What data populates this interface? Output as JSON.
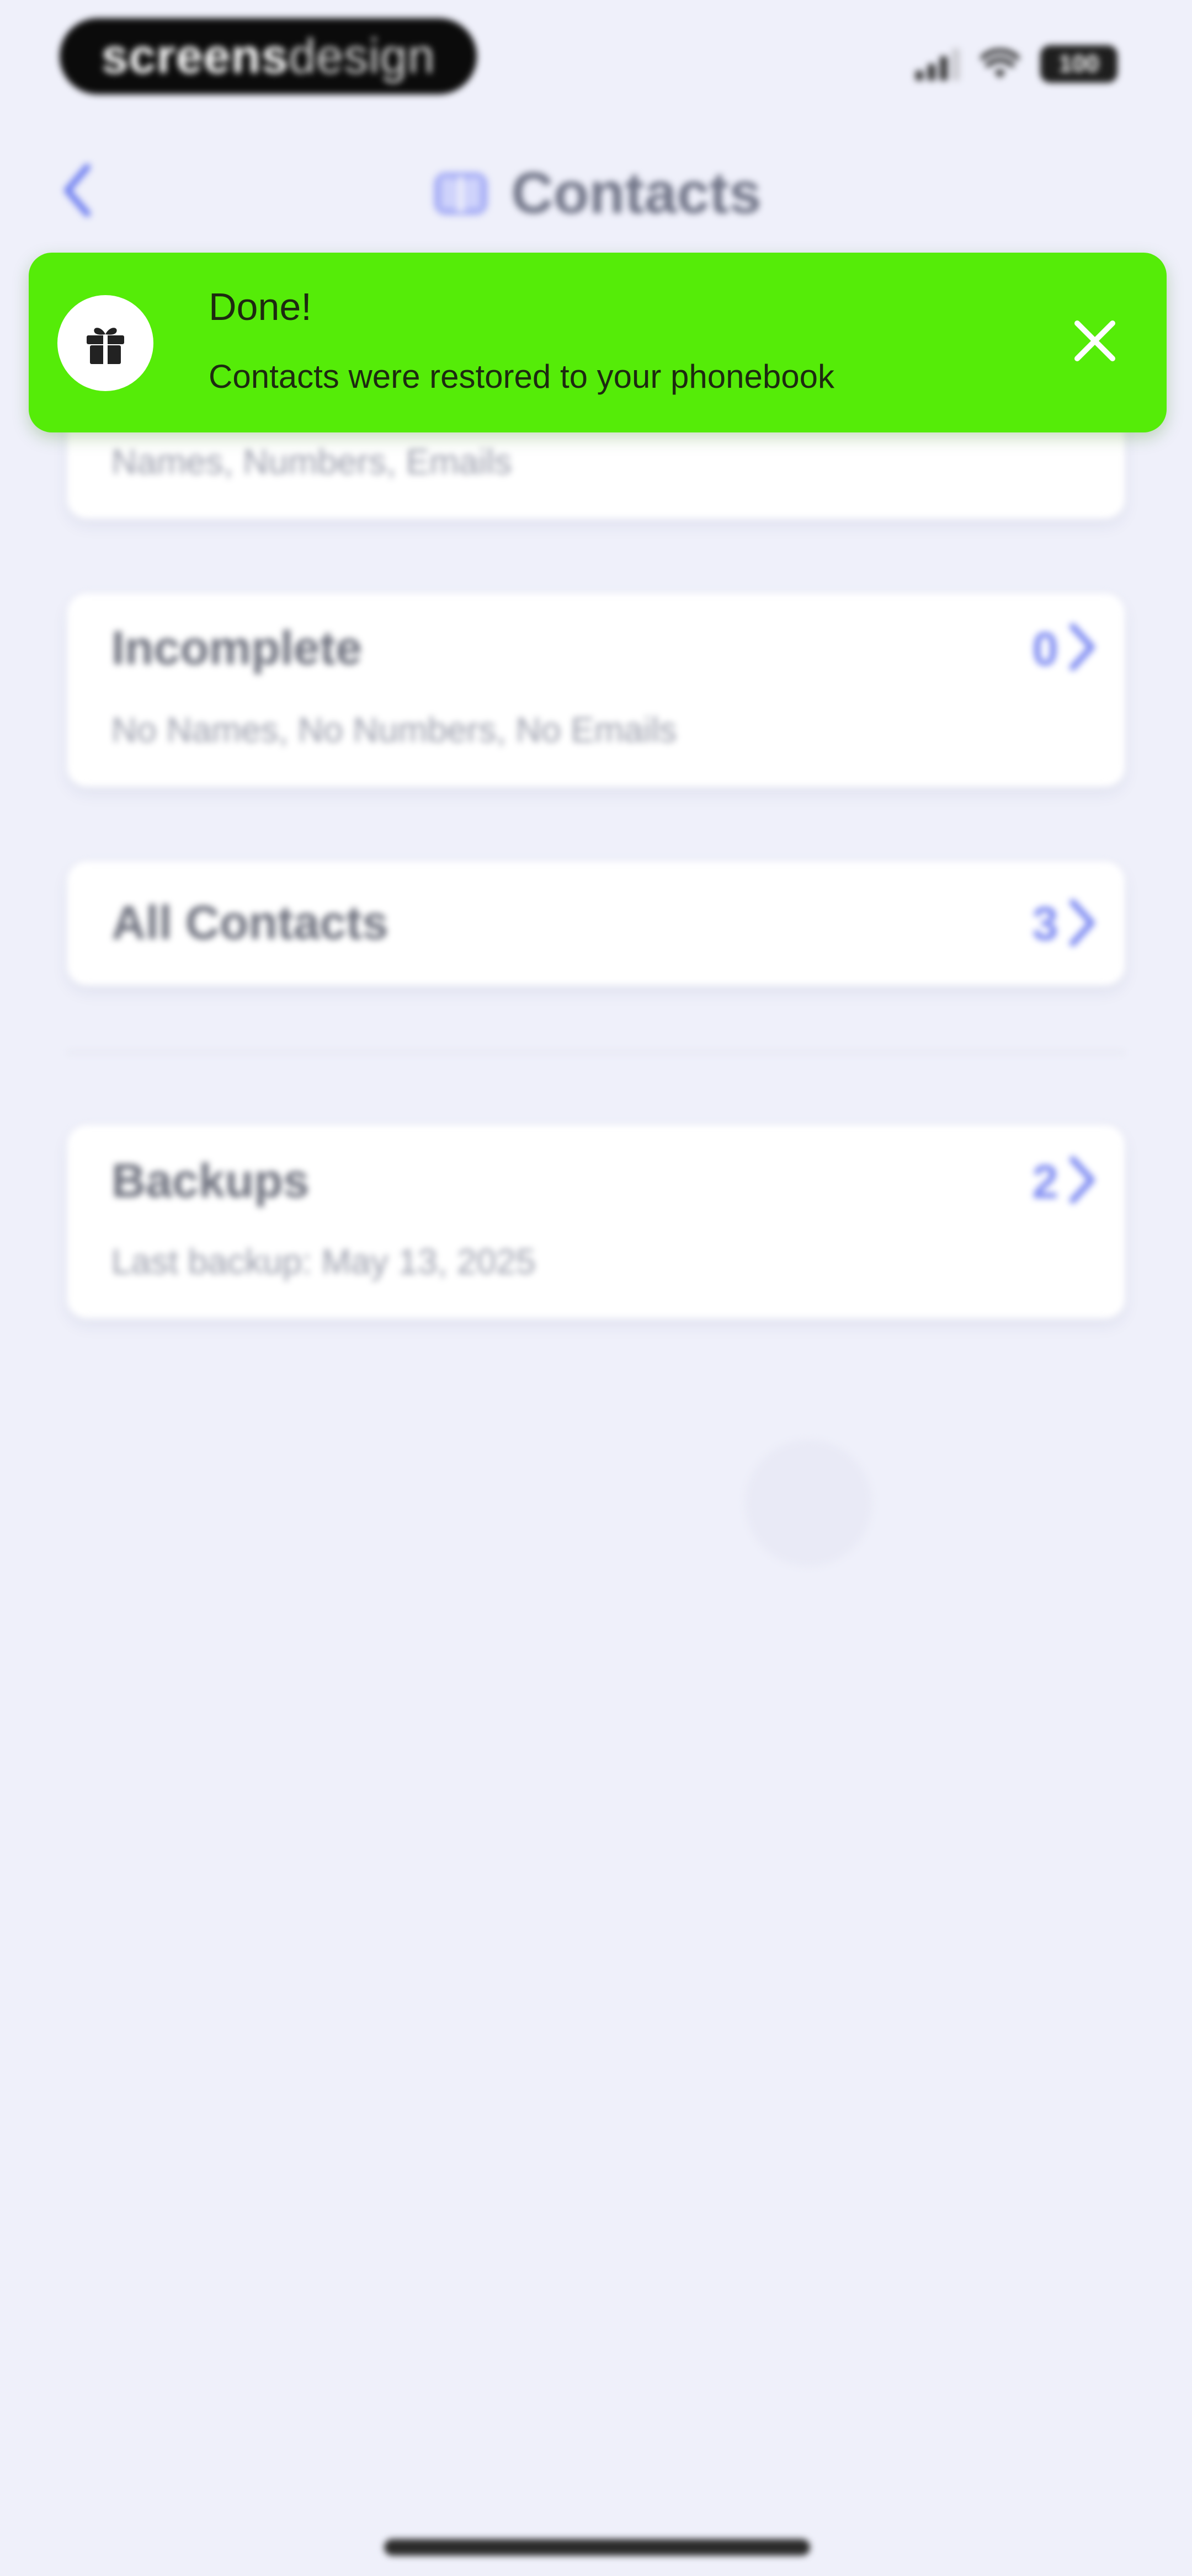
{
  "status_bar": {
    "brand_bold": "screens",
    "brand_light": "design",
    "battery": "100"
  },
  "nav": {
    "title": "Contacts",
    "back_icon": "chevron-left-icon",
    "title_icon": "book-open-icon"
  },
  "toast": {
    "title": "Done!",
    "message": "Contacts were restored to your phonebook",
    "icon": "gift-icon",
    "close_icon": "close-icon",
    "color": "#55ec08"
  },
  "cards": [
    {
      "title": "",
      "subtitle": "Names, Numbers, Emails",
      "count": ""
    },
    {
      "title": "Incomplete",
      "subtitle": "No Names, No Numbers, No Emails",
      "count": "0"
    },
    {
      "title": "All Contacts",
      "subtitle": "",
      "count": "3"
    },
    {
      "title": "Backups",
      "subtitle": "Last backup: May 13, 2025",
      "count": "2"
    }
  ],
  "colors": {
    "accent": "#7f8cf2",
    "background": "#eff0fa",
    "toast": "#55ec08"
  }
}
